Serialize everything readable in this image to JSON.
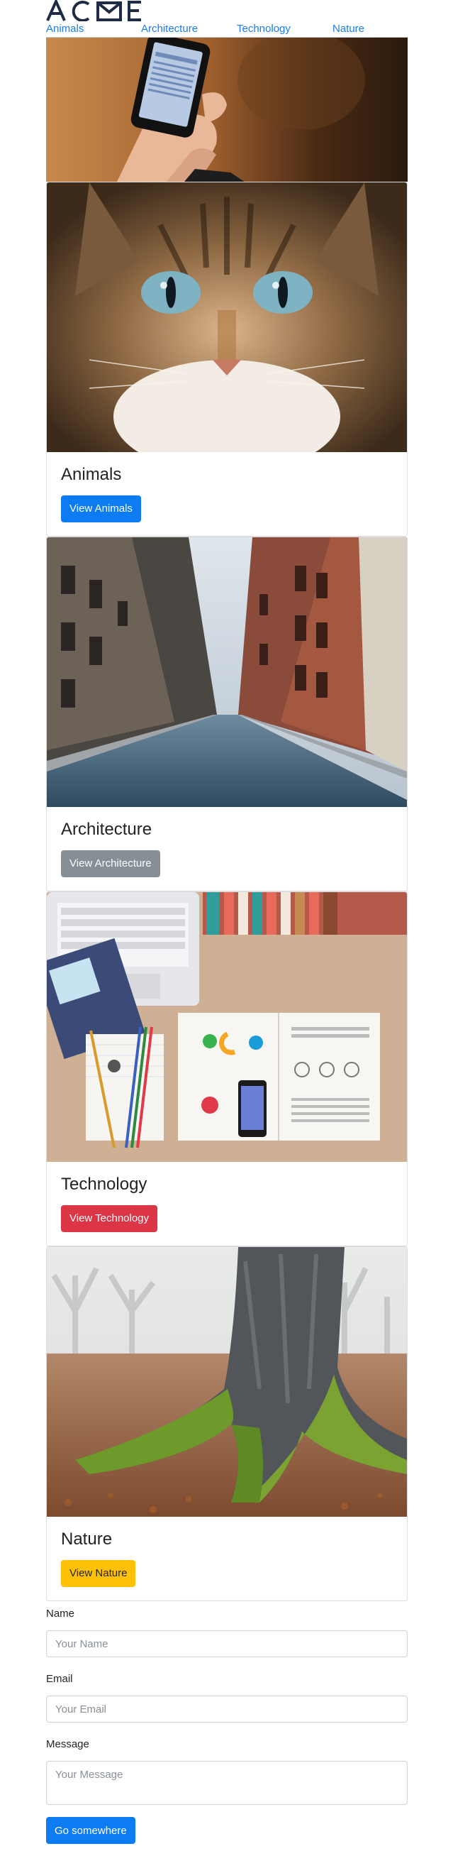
{
  "header": {
    "logo_text": "ACME",
    "nav": [
      "Animals",
      "Architecture",
      "Technology",
      "Nature"
    ]
  },
  "cards": [
    {
      "title": "Animals",
      "button": "View Animals",
      "button_color": "#0d7cf2"
    },
    {
      "title": "Architecture",
      "button": "View Architecture",
      "button_color": "#868e96"
    },
    {
      "title": "Technology",
      "button": "View Technology",
      "button_color": "#dc3545"
    },
    {
      "title": "Nature",
      "button": "View Nature",
      "button_color": "#ffc107"
    }
  ],
  "form": {
    "name_label": "Name",
    "name_placeholder": "Your Name",
    "email_label": "Email",
    "email_placeholder": "Your Email",
    "message_label": "Message",
    "message_placeholder": "Your Message",
    "submit": "Go somewhere"
  }
}
